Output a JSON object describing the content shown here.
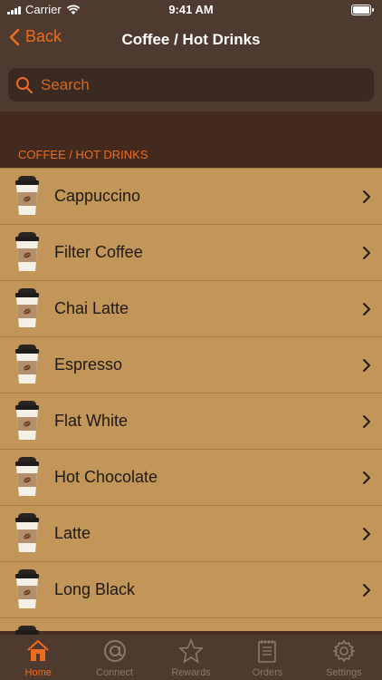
{
  "status_bar": {
    "carrier": "Carrier",
    "time": "9:41 AM"
  },
  "nav": {
    "back_label": "Back",
    "title": "Coffee / Hot Drinks"
  },
  "search": {
    "placeholder": "Search"
  },
  "section": {
    "header": "COFFEE / HOT DRINKS"
  },
  "items": [
    {
      "label": "Cappuccino"
    },
    {
      "label": "Filter Coffee"
    },
    {
      "label": "Chai Latte"
    },
    {
      "label": "Espresso"
    },
    {
      "label": "Flat White"
    },
    {
      "label": "Hot Chocolate"
    },
    {
      "label": "Latte"
    },
    {
      "label": "Long Black"
    }
  ],
  "tabs": [
    {
      "label": "Home",
      "icon": "home-icon",
      "active": true
    },
    {
      "label": "Connect",
      "icon": "at-icon",
      "active": false
    },
    {
      "label": "Rewards",
      "icon": "star-icon",
      "active": false
    },
    {
      "label": "Orders",
      "icon": "notepad-icon",
      "active": false
    },
    {
      "label": "Settings",
      "icon": "gear-icon",
      "active": false
    }
  ],
  "colors": {
    "accent": "#ee6c1c",
    "bar_bg": "#4e3a2f",
    "row_bg": "#c29558",
    "section_bg": "#44291f"
  }
}
